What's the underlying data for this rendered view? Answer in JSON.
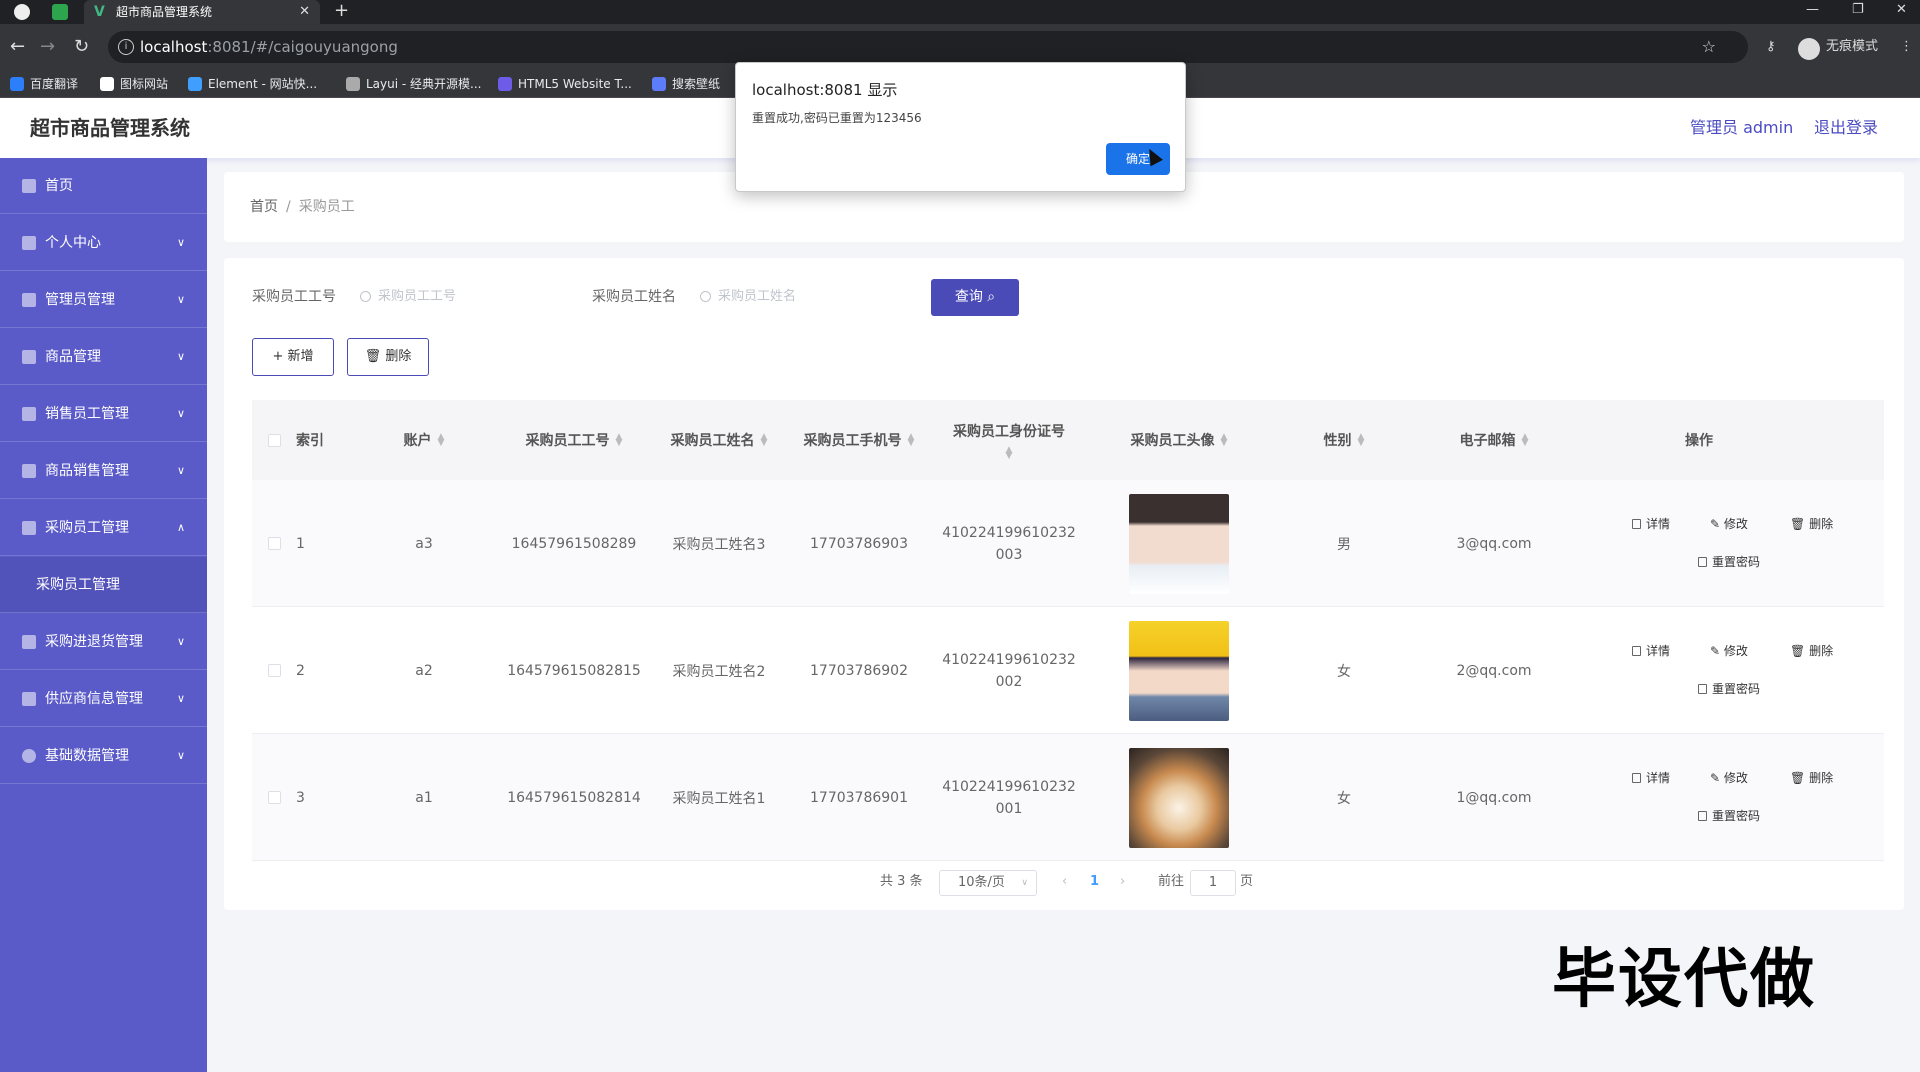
{
  "browser": {
    "tab_title": "超市商品管理系统",
    "url_host": "localhost",
    "url_rest": ":8081/#/caigouyuangong",
    "incognito_label": "无痕模式",
    "bookmarks": [
      "百度翻译",
      "图标网站",
      "Element - 网站快...",
      "Layui - 经典开源模...",
      "HTML5 Website T...",
      "搜索壁纸"
    ]
  },
  "header": {
    "title": "超市商品管理系统",
    "admin_label": "管理员 admin",
    "logout_label": "退出登录"
  },
  "sidebar": {
    "items": [
      {
        "label": "首页"
      },
      {
        "label": "个人中心"
      },
      {
        "label": "管理员管理"
      },
      {
        "label": "商品管理"
      },
      {
        "label": "销售员工管理"
      },
      {
        "label": "商品销售管理"
      },
      {
        "label": "采购员工管理"
      },
      {
        "label": "采购进退货管理"
      },
      {
        "label": "供应商信息管理"
      },
      {
        "label": "基础数据管理"
      }
    ],
    "active_sub": "采购员工管理"
  },
  "breadcrumb": {
    "home": "首页",
    "separator": "/",
    "current": "采购员工"
  },
  "search": {
    "no_label": "采购员工工号",
    "no_placeholder": "采购员工工号",
    "name_label": "采购员工姓名",
    "name_placeholder": "采购员工姓名",
    "query_label": "查询"
  },
  "toolbar": {
    "add_label": "新增",
    "delete_label": "删除"
  },
  "table": {
    "headers": {
      "index": "索引",
      "account": "账户",
      "no": "采购员工工号",
      "name": "采购员工姓名",
      "phone": "采购员工手机号",
      "id_card": "采购员工身份证号",
      "avatar": "采购员工头像",
      "gender": "性别",
      "email": "电子邮箱",
      "ops": "操作"
    },
    "rows": [
      {
        "index": "1",
        "account": "a3",
        "no": "16457961508289",
        "name": "采购员工姓名3",
        "phone": "17703786903",
        "id_line1": "410224199610232",
        "id_line2": "003",
        "gender": "男",
        "email": "3@qq.com"
      },
      {
        "index": "2",
        "account": "a2",
        "no": "164579615082815",
        "name": "采购员工姓名2",
        "phone": "17703786902",
        "id_line1": "410224199610232",
        "id_line2": "002",
        "gender": "女",
        "email": "2@qq.com"
      },
      {
        "index": "3",
        "account": "a1",
        "no": "164579615082814",
        "name": "采购员工姓名1",
        "phone": "17703786901",
        "id_line1": "410224199610232",
        "id_line2": "001",
        "gender": "女",
        "email": "1@qq.com"
      }
    ],
    "ops": {
      "detail": "详情",
      "edit": "修改",
      "delete": "删除",
      "reset": "重置密码"
    }
  },
  "pagination": {
    "total": "共 3 条",
    "page_size": "10条/页",
    "current_page": "1",
    "goto_label": "前往",
    "goto_value": "1",
    "page_suffix": "页"
  },
  "watermark": "毕设代做",
  "alert": {
    "title": "localhost:8081 显示",
    "message": "重置成功,密码已重置为123456",
    "ok_label": "确定"
  },
  "colors": {
    "primary": "#4b4bb8",
    "sidebar": "#5a5ac8",
    "alert_button": "#1a73e8"
  }
}
